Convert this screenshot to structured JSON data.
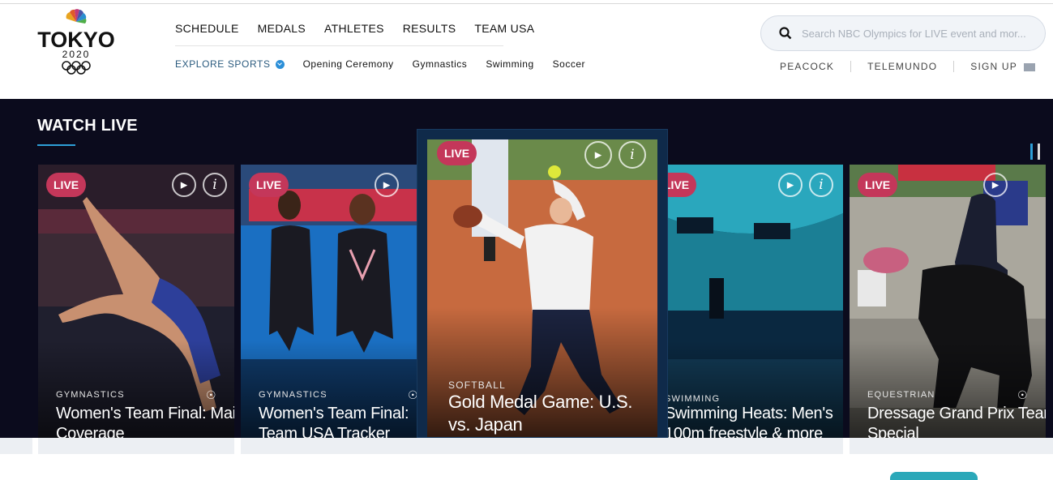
{
  "header": {
    "logo": {
      "city": "TOKYO",
      "year": "2020"
    },
    "nav_main": [
      "SCHEDULE",
      "MEDALS",
      "ATHLETES",
      "RESULTS",
      "TEAM USA"
    ],
    "explore_label": "EXPLORE SPORTS",
    "nav_sub": [
      "Opening Ceremony",
      "Gymnastics",
      "Swimming",
      "Soccer"
    ],
    "search_placeholder": "Search NBC Olympics for LIVE event and mor...",
    "util_links": [
      "PEACOCK",
      "TELEMUNDO",
      "SIGN UP"
    ]
  },
  "watch_live": {
    "title": "WATCH LIVE",
    "cards": [
      {
        "badge": "LIVE",
        "sport": "GYMNASTICS",
        "title": "Women's Team Final: Main Coverage"
      },
      {
        "badge": "LIVE",
        "sport": "GYMNASTICS",
        "title": "Women's Team Final: Team USA Tracker"
      },
      {
        "badge": "LIVE",
        "sport": "SOFTBALL",
        "title": "Gold Medal Game: U.S. vs. Japan"
      },
      {
        "badge": "LIVE",
        "sport": "SWIMMING",
        "title": "Swimming Heats: Men's 100m freestyle & more"
      },
      {
        "badge": "LIVE",
        "sport": "EQUESTRIAN",
        "title": "Dressage Grand Prix Team Special"
      }
    ]
  },
  "colors": {
    "live_badge": "#c4375a",
    "dark_bg": "#0b0b1d",
    "accent": "#2e9fd8"
  }
}
